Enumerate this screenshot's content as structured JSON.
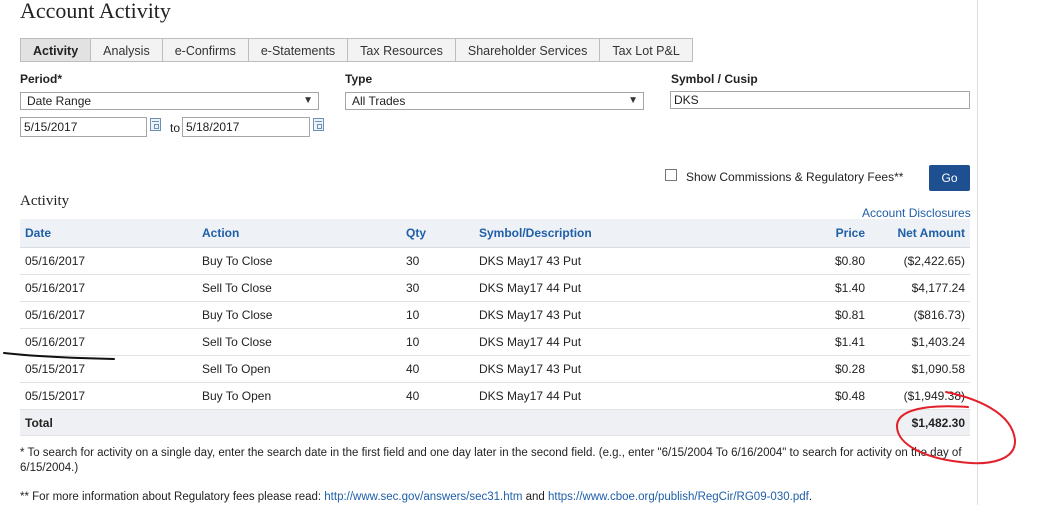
{
  "title": "Account Activity",
  "tabs": [
    {
      "label": "Activity",
      "active": true
    },
    {
      "label": "Analysis",
      "active": false
    },
    {
      "label": "e-Confirms",
      "active": false
    },
    {
      "label": "e-Statements",
      "active": false
    },
    {
      "label": "Tax Resources",
      "active": false
    },
    {
      "label": "Shareholder Services",
      "active": false
    },
    {
      "label": "Tax Lot P&L",
      "active": false
    }
  ],
  "filters": {
    "period_label": "Period*",
    "period_value": "Date Range",
    "start_date": "5/15/2017",
    "to_label": "to",
    "end_date": "5/18/2017",
    "type_label": "Type",
    "type_value": "All Trades",
    "symbol_label": "Symbol / Cusip",
    "symbol_value": "DKS",
    "show_fees_label": "Show Commissions & Regulatory Fees**",
    "show_fees_checked": false,
    "go_label": "Go"
  },
  "activity": {
    "section_title": "Activity",
    "disclosures_link": "Account Disclosures",
    "columns": {
      "date": "Date",
      "action": "Action",
      "qty": "Qty",
      "symbol": "Symbol/Description",
      "price": "Price",
      "net": "Net Amount"
    },
    "rows": [
      {
        "date": "05/16/2017",
        "action": "Buy To Close",
        "qty": "30",
        "symbol": "DKS May17 43 Put",
        "price": "$0.80",
        "net": "($2,422.65)"
      },
      {
        "date": "05/16/2017",
        "action": "Sell To Close",
        "qty": "30",
        "symbol": "DKS May17 44 Put",
        "price": "$1.40",
        "net": "$4,177.24"
      },
      {
        "date": "05/16/2017",
        "action": "Buy To Close",
        "qty": "10",
        "symbol": "DKS May17 43 Put",
        "price": "$0.81",
        "net": "($816.73)"
      },
      {
        "date": "05/16/2017",
        "action": "Sell To Close",
        "qty": "10",
        "symbol": "DKS May17 44 Put",
        "price": "$1.41",
        "net": "$1,403.24"
      },
      {
        "date": "05/15/2017",
        "action": "Sell To Open",
        "qty": "40",
        "symbol": "DKS May17 43 Put",
        "price": "$0.28",
        "net": "$1,090.58"
      },
      {
        "date": "05/15/2017",
        "action": "Buy To Open",
        "qty": "40",
        "symbol": "DKS May17 44 Put",
        "price": "$0.48",
        "net": "($1,949.38)"
      }
    ],
    "total_label": "Total",
    "total_value": "$1,482.30"
  },
  "footnotes": {
    "note1": "* To search for activity on a single day, enter the search date in the first field and one day later in the second field. (e.g., enter \"6/15/2004 To 6/16/2004\" to search for activity on the day of 6/15/2004.)",
    "note2_prefix": "** For more information about Regulatory fees please read: ",
    "note2_link1": "http://www.sec.gov/answers/sec31.htm",
    "note2_and": " and ",
    "note2_link2": "https://www.cboe.org/publish/RegCir/RG09-030.pdf",
    "note2_suffix": "."
  },
  "colors": {
    "link": "#1f5fa8",
    "go_button": "#1d4f91",
    "annotation": "#e3202a"
  }
}
